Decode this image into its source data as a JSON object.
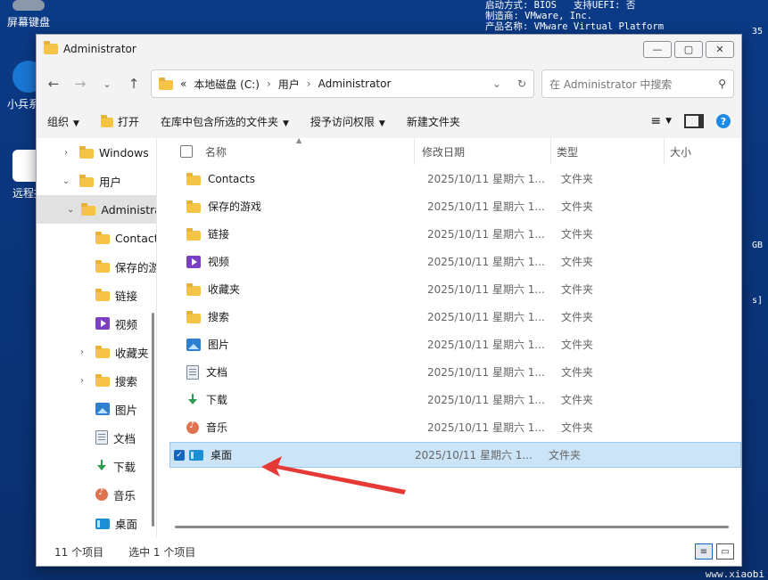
{
  "desktop": {
    "icons": [
      {
        "label": "屏幕键盘"
      },
      {
        "label": "小兵系统"
      },
      {
        "label": "远程控"
      }
    ],
    "sysinfo_lines": [
      "启动方式: BIOS   支持UEFI: 否",
      "制造商: VMware, Inc.",
      "产品名称: VMware Virtual Platform"
    ],
    "side_texts": [
      "GB",
      "s]",
      "35"
    ],
    "watermark": "www.xiaobi"
  },
  "window": {
    "title": "Administrator",
    "buttons": {
      "minimize": "—",
      "maximize": "▢",
      "close": "✕"
    }
  },
  "address": {
    "overflow": "«",
    "crumbs": [
      "本地磁盘 (C:)",
      "用户",
      "Administrator"
    ],
    "search_placeholder": "在 Administrator 中搜索"
  },
  "toolbar": {
    "organize": "组织",
    "open": "打开",
    "include_library": "在库中包含所选的文件夹",
    "give_access": "授予访问权限",
    "new_folder": "新建文件夹",
    "help": "?"
  },
  "nav": [
    {
      "label": "Windows",
      "icon": "folder",
      "indent": 26,
      "chev": "›"
    },
    {
      "label": "用户",
      "icon": "folder",
      "indent": 26,
      "chev": "⌄"
    },
    {
      "label": "Administrator",
      "icon": "folder",
      "indent": 34,
      "chev": "⌄",
      "selected": true
    },
    {
      "label": "Contacts",
      "icon": "folder",
      "indent": 58,
      "chev": ""
    },
    {
      "label": "保存的游戏",
      "icon": "folder",
      "indent": 58,
      "chev": ""
    },
    {
      "label": "链接",
      "icon": "folder",
      "indent": 58,
      "chev": ""
    },
    {
      "label": "视频",
      "icon": "video",
      "indent": 58,
      "chev": ""
    },
    {
      "label": "收藏夹",
      "icon": "folder",
      "indent": 44,
      "chev": "›"
    },
    {
      "label": "搜索",
      "icon": "folder",
      "indent": 44,
      "chev": "›"
    },
    {
      "label": "图片",
      "icon": "picture",
      "indent": 58,
      "chev": ""
    },
    {
      "label": "文档",
      "icon": "document",
      "indent": 58,
      "chev": ""
    },
    {
      "label": "下载",
      "icon": "download",
      "indent": 58,
      "chev": ""
    },
    {
      "label": "音乐",
      "icon": "music",
      "indent": 58,
      "chev": ""
    },
    {
      "label": "桌面",
      "icon": "desktop",
      "indent": 58,
      "chev": ""
    }
  ],
  "columns": {
    "name": "名称",
    "modified": "修改日期",
    "type": "类型",
    "size": "大小"
  },
  "files": [
    {
      "name": "Contacts",
      "icon": "folder",
      "modified": "2025/10/11 星期六 1...",
      "type": "文件夹"
    },
    {
      "name": "保存的游戏",
      "icon": "folder",
      "modified": "2025/10/11 星期六 1...",
      "type": "文件夹"
    },
    {
      "name": "链接",
      "icon": "folder",
      "modified": "2025/10/11 星期六 1...",
      "type": "文件夹"
    },
    {
      "name": "视频",
      "icon": "video",
      "modified": "2025/10/11 星期六 1...",
      "type": "文件夹"
    },
    {
      "name": "收藏夹",
      "icon": "folder",
      "modified": "2025/10/11 星期六 1...",
      "type": "文件夹"
    },
    {
      "name": "搜索",
      "icon": "folder",
      "modified": "2025/10/11 星期六 1...",
      "type": "文件夹"
    },
    {
      "name": "图片",
      "icon": "picture",
      "modified": "2025/10/11 星期六 1...",
      "type": "文件夹"
    },
    {
      "name": "文档",
      "icon": "document",
      "modified": "2025/10/11 星期六 1...",
      "type": "文件夹"
    },
    {
      "name": "下载",
      "icon": "download",
      "modified": "2025/10/11 星期六 1...",
      "type": "文件夹"
    },
    {
      "name": "音乐",
      "icon": "music",
      "modified": "2025/10/11 星期六 1...",
      "type": "文件夹"
    },
    {
      "name": "桌面",
      "icon": "desktop",
      "modified": "2025/10/11 星期六 1...",
      "type": "文件夹",
      "selected": true
    }
  ],
  "status": {
    "count": "11 个项目",
    "selected": "选中 1 个项目"
  },
  "colors": {
    "selection": "#cce4f7",
    "accent": "#1565c0",
    "arrow": "#e53935"
  }
}
